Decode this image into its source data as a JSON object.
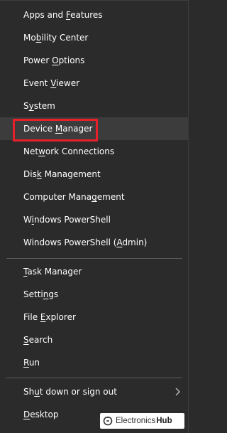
{
  "menu": {
    "group1": [
      {
        "pre": "Apps and ",
        "key": "F",
        "post": "eatures"
      },
      {
        "pre": "Mo",
        "key": "b",
        "post": "ility Center"
      },
      {
        "pre": "Power ",
        "key": "O",
        "post": "ptions"
      },
      {
        "pre": "Event ",
        "key": "V",
        "post": "iewer"
      },
      {
        "pre": "S",
        "key": "y",
        "post": "stem"
      },
      {
        "pre": "Device ",
        "key": "M",
        "post": "anager"
      },
      {
        "pre": "Net",
        "key": "w",
        "post": "ork Connections"
      },
      {
        "pre": "Dis",
        "key": "k",
        "post": " Management"
      },
      {
        "pre": "Computer Mana",
        "key": "g",
        "post": "ement"
      },
      {
        "pre": "W",
        "key": "i",
        "post": "ndows PowerShell"
      },
      {
        "pre": "Windows PowerShell (",
        "key": "A",
        "post": "dmin)"
      }
    ],
    "group2": [
      {
        "pre": "",
        "key": "T",
        "post": "ask Manager"
      },
      {
        "pre": "Setti",
        "key": "n",
        "post": "gs"
      },
      {
        "pre": "File ",
        "key": "E",
        "post": "xplorer"
      },
      {
        "pre": "",
        "key": "S",
        "post": "earch"
      },
      {
        "pre": "",
        "key": "R",
        "post": "un"
      }
    ],
    "group3": [
      {
        "pre": "Sh",
        "key": "u",
        "post": "t down or sign out"
      },
      {
        "pre": "",
        "key": "D",
        "post": "esktop"
      }
    ],
    "submenu_icon": "chevron-right-icon",
    "highlight_color": "#e8202a"
  },
  "watermark": {
    "text1": "Electronics",
    "text2": "Hub",
    "icon": "electronicshub-logo-icon"
  }
}
